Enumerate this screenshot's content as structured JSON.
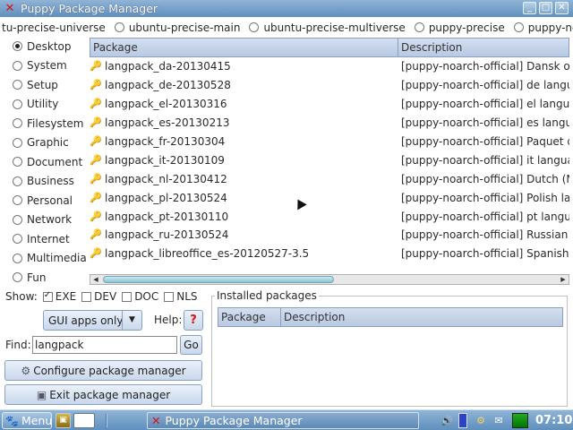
{
  "window": {
    "title": "Puppy Package Manager",
    "app_icon": "x-icon"
  },
  "repos": [
    {
      "label": "tu-precise-universe",
      "selected": false
    },
    {
      "label": "ubuntu-precise-main",
      "selected": false
    },
    {
      "label": "ubuntu-precise-multiverse",
      "selected": false
    },
    {
      "label": "puppy-precise",
      "selected": false
    },
    {
      "label": "puppy-noarch",
      "selected": true
    }
  ],
  "categories": [
    {
      "label": "Desktop",
      "selected": true
    },
    {
      "label": "System",
      "selected": false
    },
    {
      "label": "Setup",
      "selected": false
    },
    {
      "label": "Utility",
      "selected": false
    },
    {
      "label": "Filesystem",
      "selected": false
    },
    {
      "label": "Graphic",
      "selected": false
    },
    {
      "label": "Document",
      "selected": false
    },
    {
      "label": "Business",
      "selected": false
    },
    {
      "label": "Personal",
      "selected": false
    },
    {
      "label": "Network",
      "selected": false
    },
    {
      "label": "Internet",
      "selected": false
    },
    {
      "label": "Multimedia",
      "selected": false
    },
    {
      "label": "Fun",
      "selected": false
    }
  ],
  "packages": {
    "columns": [
      "Package",
      "Description"
    ],
    "rows": [
      {
        "name": "langpack_da-20130415",
        "description": "[puppy-noarch-official] Dansk ov"
      },
      {
        "name": "langpack_de-20130528",
        "description": "[puppy-noarch-official] de langua"
      },
      {
        "name": "langpack_el-20130316",
        "description": "[puppy-noarch-official] el langua"
      },
      {
        "name": "langpack_es-20130213",
        "description": "[puppy-noarch-official] es langua"
      },
      {
        "name": "langpack_fr-20130304",
        "description": "[puppy-noarch-official] Paquet d"
      },
      {
        "name": "langpack_it-20130109",
        "description": "[puppy-noarch-official] it languag"
      },
      {
        "name": "langpack_nl-20130412",
        "description": "[puppy-noarch-official] Dutch (N"
      },
      {
        "name": "langpack_pl-20130524",
        "description": "[puppy-noarch-official] Polish lan"
      },
      {
        "name": "langpack_pt-20130110",
        "description": "[puppy-noarch-official] pt langua"
      },
      {
        "name": "langpack_ru-20130524",
        "description": "[puppy-noarch-official] Russian l"
      },
      {
        "name": "langpack_libreoffice_es-20120527-3.5",
        "description": "[puppy-noarch-official] Spanish l"
      }
    ]
  },
  "show": {
    "label": "Show:",
    "options": [
      {
        "label": "EXE",
        "checked": true
      },
      {
        "label": "DEV",
        "checked": false
      },
      {
        "label": "DOC",
        "checked": false
      },
      {
        "label": "NLS",
        "checked": false
      }
    ]
  },
  "filter": {
    "value": "GUI apps only"
  },
  "help": {
    "label": "Help:",
    "button": "?"
  },
  "find": {
    "label": "Find:",
    "value": "langpack",
    "go_label": "Go"
  },
  "buttons": {
    "configure": "Configure package manager",
    "exit": "Exit package manager"
  },
  "installed": {
    "legend": "Installed packages",
    "columns": [
      "Package",
      "Description"
    ]
  },
  "taskbar": {
    "menu_label": "Menu",
    "task_title": "Puppy Package Manager",
    "clock": "07:10"
  }
}
